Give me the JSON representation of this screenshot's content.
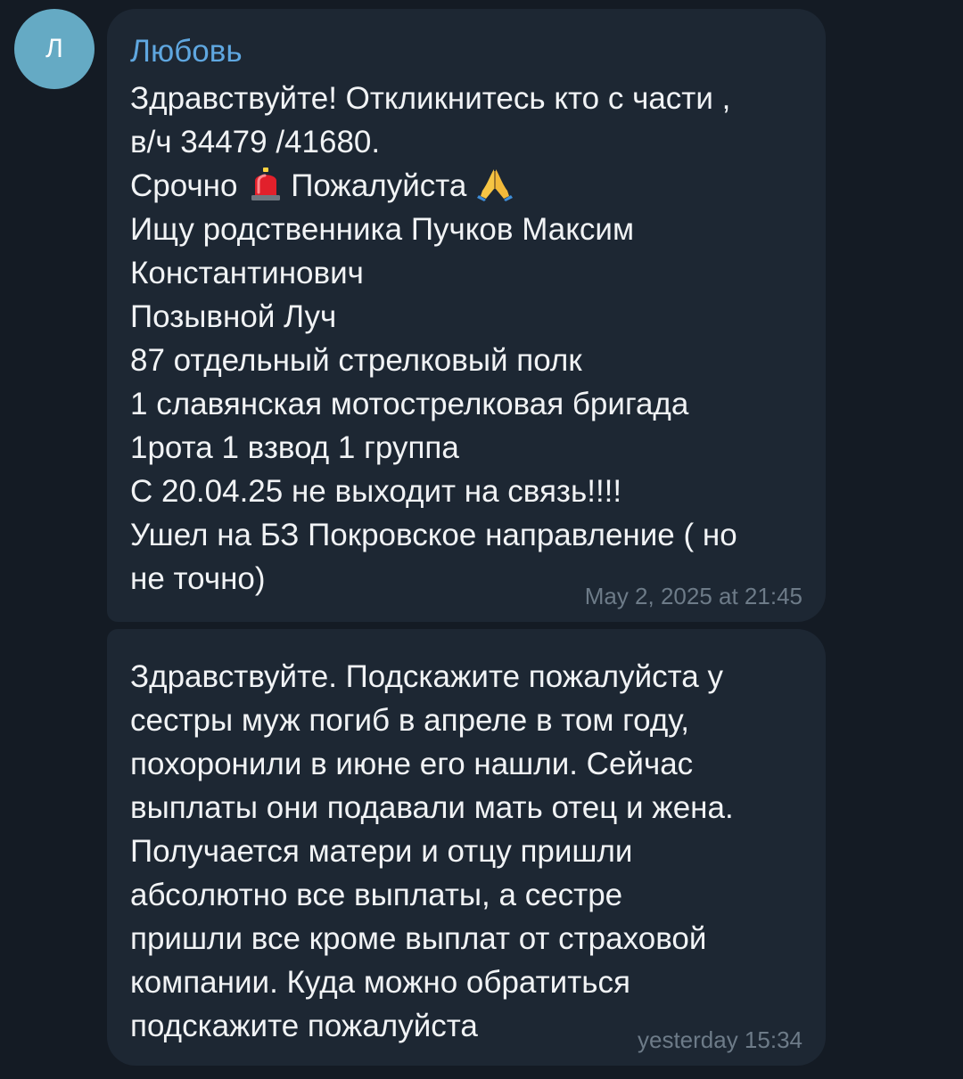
{
  "messages": [
    {
      "avatar_letter": "Л",
      "sender": "Любовь",
      "lines_before_emoji": [
        "Здравствуйте! Откликнитесь кто с части ,",
        "в/ч 34479 /41680."
      ],
      "urgent_word": "Срочно",
      "please_word": "Пожалуйста",
      "emoji_1": "rotating-light-icon",
      "emoji_2": "folded-hands-icon",
      "lines_after_emoji": "Ищу родственника Пучков Максим\nКонстантинович\nПозывной Луч\n87 отдельный стрелковый полк\n1 славянская мотострелковая бригада\n1рота 1 взвод 1 группа\nС 20.04.25 не выходит на связь!!!!\nУшел на БЗ Покровское направление ( но\nне точно)",
      "timestamp": "May 2, 2025 at 21:45"
    },
    {
      "text": "Здравствуйте. Подскажите пожалуйста у\nсестры муж погиб в апреле в том году,\nпохоронили в июне его нашли. Сейчас\nвыплаты они подавали мать отец и жена.\nПолучается матери и отцу пришли\nабсолютно все выплаты, а сестре\nпришли все кроме выплат от страховой\nкомпании. Куда можно обратиться\nподскажите пожалуйста",
      "timestamp": "yesterday 15:34"
    }
  ],
  "colors": {
    "background": "#141b24",
    "bubble": "#1d2733",
    "avatar": "#65aac4",
    "sender": "#5fa7e0",
    "text": "#f1f3f5",
    "timestamp": "#6d7b88"
  }
}
